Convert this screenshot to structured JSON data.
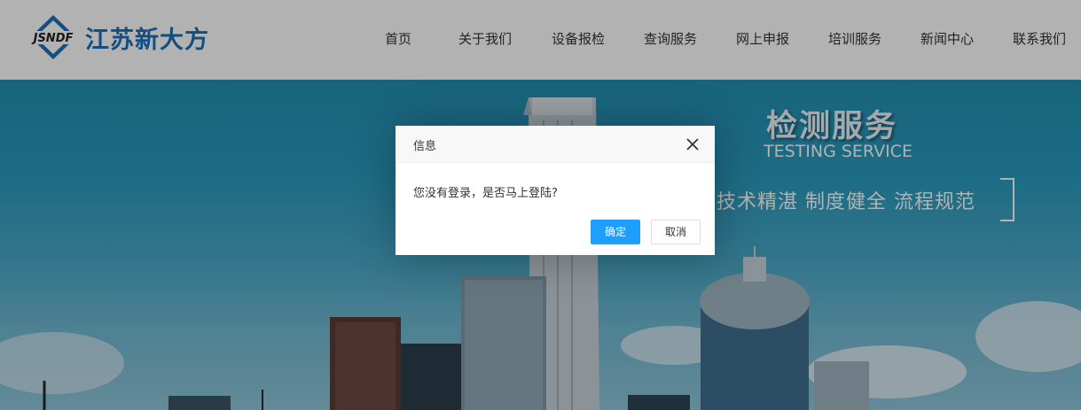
{
  "header": {
    "brand": "江苏新大方",
    "logo_text": "JSNDF",
    "nav": [
      "首页",
      "关于我们",
      "设备报检",
      "查询服务",
      "网上申报",
      "培训服务",
      "新闻中心",
      "联系我们"
    ]
  },
  "banner": {
    "title": "检测服务",
    "title_en": "TESTING SERVICE",
    "subtitle": "技术精湛  制度健全  流程规范"
  },
  "dialog": {
    "title": "信息",
    "message": "您没有登录，是否马上登陆?",
    "ok_label": "确定",
    "cancel_label": "取消"
  },
  "colors": {
    "brand": "#1e6fb7",
    "primary_button": "#1e9fff",
    "overlay": "rgba(0,0,0,0.3)"
  }
}
